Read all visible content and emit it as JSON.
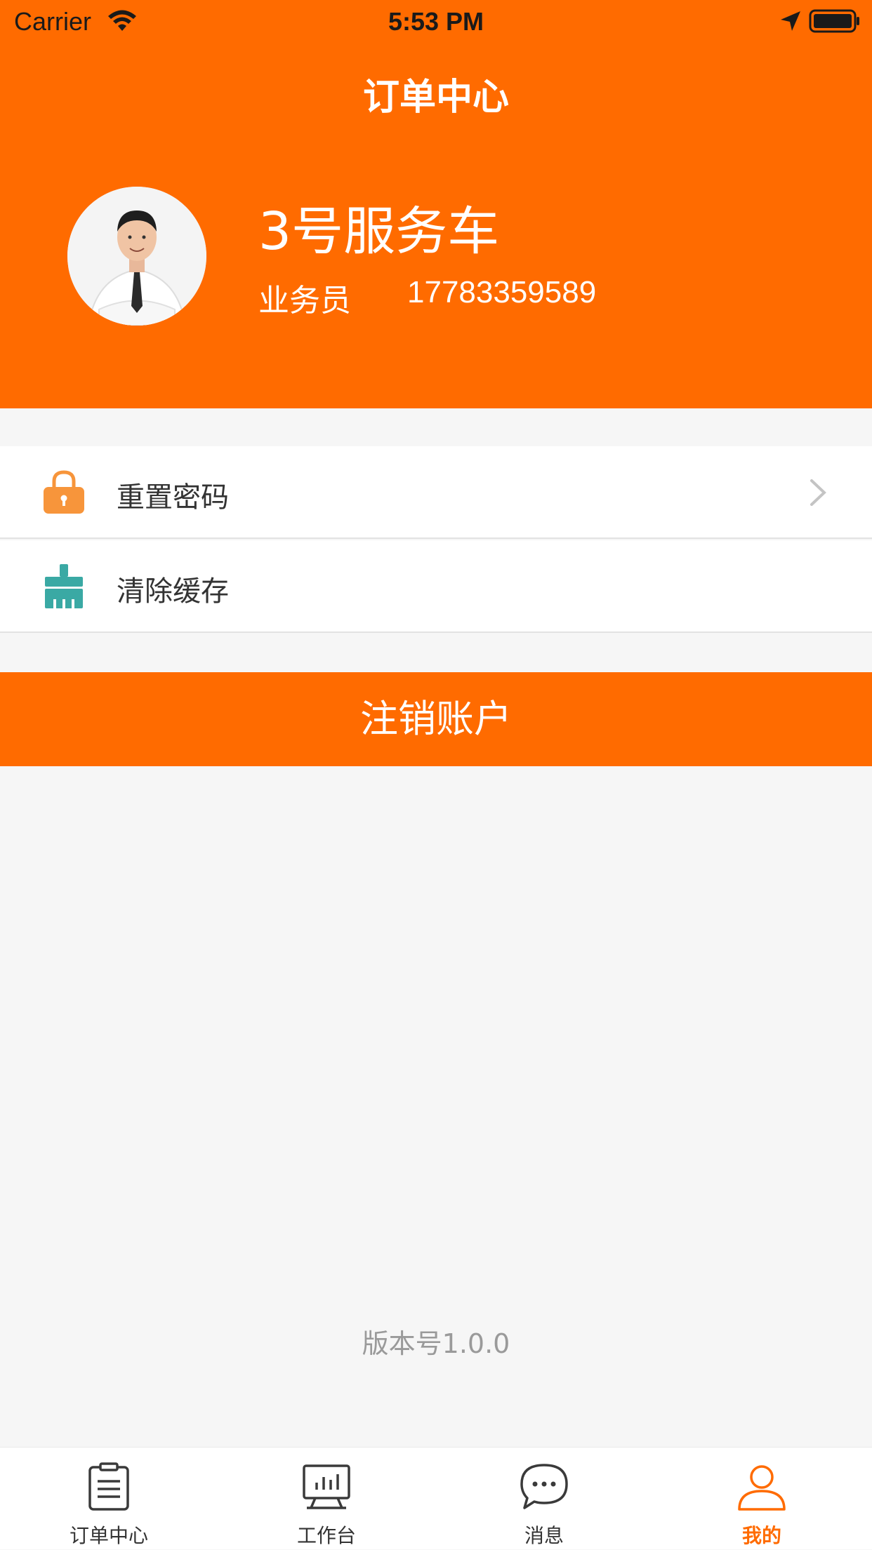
{
  "status_bar": {
    "carrier": "Carrier",
    "time": "5:53 PM",
    "icons": [
      "wifi-icon",
      "location-arrow-icon",
      "battery-icon"
    ]
  },
  "header": {
    "title": "订单中心",
    "avatar": "avatar",
    "user_name": "3号服务车",
    "user_role": "业务员",
    "user_phone": "17783359589"
  },
  "menu": {
    "items": [
      {
        "label": "重置密码",
        "icon": "lock-icon",
        "has_chevron": true
      },
      {
        "label": "清除缓存",
        "icon": "brush-icon",
        "has_chevron": false
      }
    ]
  },
  "logout_button": {
    "label": "注销账户"
  },
  "version": "版本号1.0.0",
  "tab_bar": {
    "tabs": [
      {
        "label": "订单中心",
        "icon": "clipboard-icon",
        "active": false
      },
      {
        "label": "工作台",
        "icon": "chart-board-icon",
        "active": false
      },
      {
        "label": "消息",
        "icon": "chat-bubble-icon",
        "active": false
      },
      {
        "label": "我的",
        "icon": "user-icon",
        "active": true
      }
    ]
  },
  "colors": {
    "accent": "#ff6b00",
    "background": "#f6f6f6",
    "lock_icon": "#f7953b",
    "brush_icon": "#3aa9a4",
    "inactive_tab": "#333333"
  }
}
